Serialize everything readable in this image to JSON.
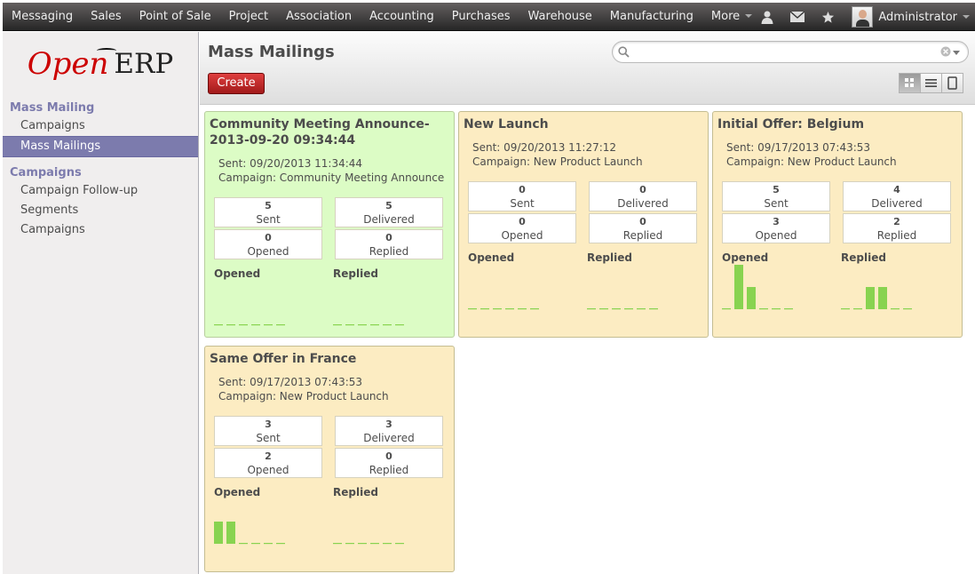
{
  "top_menu": {
    "items": [
      "Messaging",
      "Sales",
      "Point of Sale",
      "Project",
      "Association",
      "Accounting",
      "Purchases",
      "Warehouse",
      "Manufacturing",
      "More"
    ],
    "user": "Administrator"
  },
  "logo": {
    "open": "Open",
    "erp": "ERP"
  },
  "sidebar": {
    "sections": [
      {
        "title": "Mass Mailing",
        "items": [
          "Campaigns",
          "Mass Mailings"
        ]
      },
      {
        "title": "Campaigns",
        "items": [
          "Campaign Follow-up",
          "Segments",
          "Campaigns"
        ]
      }
    ],
    "active_item": "Mass Mailings"
  },
  "header": {
    "title": "Mass Mailings",
    "create_label": "Create",
    "search_placeholder": "",
    "view_modes": [
      "kanban-icon",
      "list-icon",
      "form-icon"
    ],
    "active_view": "kanban-icon"
  },
  "colors": {
    "spark_bar": "#88d350",
    "card_yellow": "#fcecc2",
    "card_green": "#dcfcc5",
    "accent": "#7c7bad",
    "create": "#c02828"
  },
  "cards": [
    {
      "title": "Community Meeting Announce-2013-09-20 09:34:44",
      "sent_label": "Sent: 09/20/2013 11:34:44",
      "campaign_label": "Campaign: Community Meeting Announce",
      "color": "green",
      "stats": {
        "sent": "5",
        "delivered": "5",
        "opened": "0",
        "replied": "0"
      },
      "stat_labels": {
        "sent": "Sent",
        "delivered": "Delivered",
        "opened": "Opened",
        "replied": "Replied"
      },
      "graph_labels": {
        "opened": "Opened",
        "replied": "Replied"
      },
      "opened_series": [
        0,
        0,
        0,
        0,
        0,
        0
      ],
      "replied_series": [
        0,
        0,
        0,
        0,
        0,
        0
      ]
    },
    {
      "title": "New Launch",
      "sent_label": "Sent: 09/20/2013 11:27:12",
      "campaign_label": "Campaign: New Product Launch",
      "color": "yellow",
      "stats": {
        "sent": "0",
        "delivered": "0",
        "opened": "0",
        "replied": "0"
      },
      "stat_labels": {
        "sent": "Sent",
        "delivered": "Delivered",
        "opened": "Opened",
        "replied": "Replied"
      },
      "graph_labels": {
        "opened": "Opened",
        "replied": "Replied"
      },
      "opened_series": [
        0,
        0,
        0,
        0,
        0,
        0
      ],
      "replied_series": [
        0,
        0,
        0,
        0,
        0,
        0
      ]
    },
    {
      "title": "Initial Offer: Belgium",
      "sent_label": "Sent: 09/17/2013 07:43:53",
      "campaign_label": "Campaign: New Product Launch",
      "color": "yellow",
      "stats": {
        "sent": "5",
        "delivered": "4",
        "opened": "3",
        "replied": "2"
      },
      "stat_labels": {
        "sent": "Sent",
        "delivered": "Delivered",
        "opened": "Opened",
        "replied": "Replied"
      },
      "graph_labels": {
        "opened": "Opened",
        "replied": "Replied"
      },
      "opened_series": [
        0,
        2,
        1,
        0,
        0,
        0
      ],
      "replied_series": [
        0,
        0,
        1,
        1,
        0,
        0
      ]
    },
    {
      "title": "Same Offer in France",
      "sent_label": "Sent: 09/17/2013 07:43:53",
      "campaign_label": "Campaign: New Product Launch",
      "color": "yellow",
      "stats": {
        "sent": "3",
        "delivered": "3",
        "opened": "2",
        "replied": "0"
      },
      "stat_labels": {
        "sent": "Sent",
        "delivered": "Delivered",
        "opened": "Opened",
        "replied": "Replied"
      },
      "graph_labels": {
        "opened": "Opened",
        "replied": "Replied"
      },
      "opened_series": [
        1,
        1,
        0,
        0,
        0,
        0
      ],
      "replied_series": [
        0,
        0,
        0,
        0,
        0,
        0
      ]
    }
  ]
}
